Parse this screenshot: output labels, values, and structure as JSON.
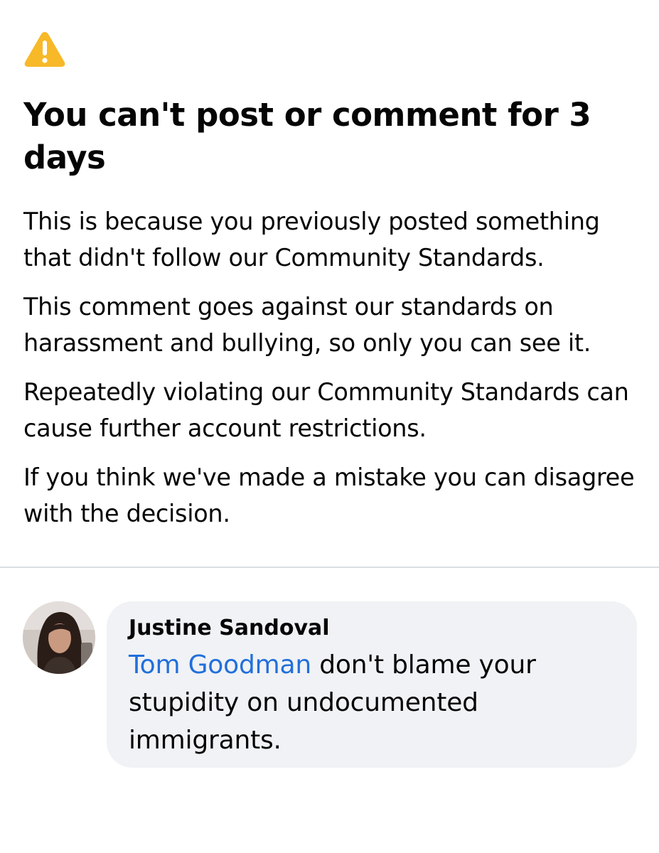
{
  "notice": {
    "icon": "warning-icon",
    "icon_color": "#f7b928",
    "title": "You can't post or comment for 3 days",
    "paragraphs": [
      "This is because you previously posted something that didn't follow our Community Standards.",
      "This comment goes against our standards on harassment and bullying, so only you can see it.",
      "Repeatedly violating our Community Standards can cause further account restrictions.",
      "If you think we've made a mistake you can disagree with the decision."
    ]
  },
  "comment": {
    "avatar": "avatar",
    "author": "Justine Sandoval",
    "mention": "Tom Goodman",
    "mention_color": "#216fdb",
    "text": " don't blame your stupidity on undocumented immigrants."
  }
}
